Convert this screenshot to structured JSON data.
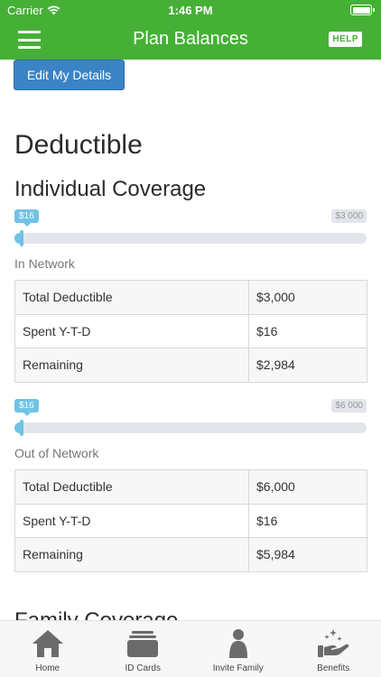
{
  "status_bar": {
    "carrier": "Carrier",
    "time": "1:46 PM"
  },
  "nav": {
    "title": "Plan Balances",
    "help_label": "HELP",
    "menu_icon": "hamburger-menu-icon"
  },
  "edit_details_label": "Edit My Details",
  "deductible_heading": "Deductible",
  "individual_heading": "Individual Coverage",
  "family_heading": "Family Coverage",
  "colors": {
    "brand_green": "#45b035",
    "button_blue": "#3a84c5",
    "progress_blue": "#70c3e4",
    "track_gray": "#e3e5ec"
  },
  "in_network": {
    "label": "In Network",
    "progress": {
      "spent": 16,
      "max": 3000,
      "spent_label": "$16",
      "max_label": "$3 000"
    },
    "rows": [
      {
        "label": "Total Deductible",
        "value": "$3,000"
      },
      {
        "label": "Spent Y-T-D",
        "value": "$16"
      },
      {
        "label": "Remaining",
        "value": "$2,984"
      }
    ]
  },
  "out_of_network": {
    "label": "Out of Network",
    "progress": {
      "spent": 16,
      "max": 6000,
      "spent_label": "$16",
      "max_label": "$6 000"
    },
    "rows": [
      {
        "label": "Total Deductible",
        "value": "$6,000"
      },
      {
        "label": "Spent Y-T-D",
        "value": "$16"
      },
      {
        "label": "Remaining",
        "value": "$5,984"
      }
    ]
  },
  "tabs": [
    {
      "label": "Home",
      "icon": "home-icon"
    },
    {
      "label": "ID Cards",
      "icon": "id-cards-icon"
    },
    {
      "label": "Invite Family",
      "icon": "person-icon"
    },
    {
      "label": "Benefits",
      "icon": "benefits-hand-icon"
    }
  ]
}
